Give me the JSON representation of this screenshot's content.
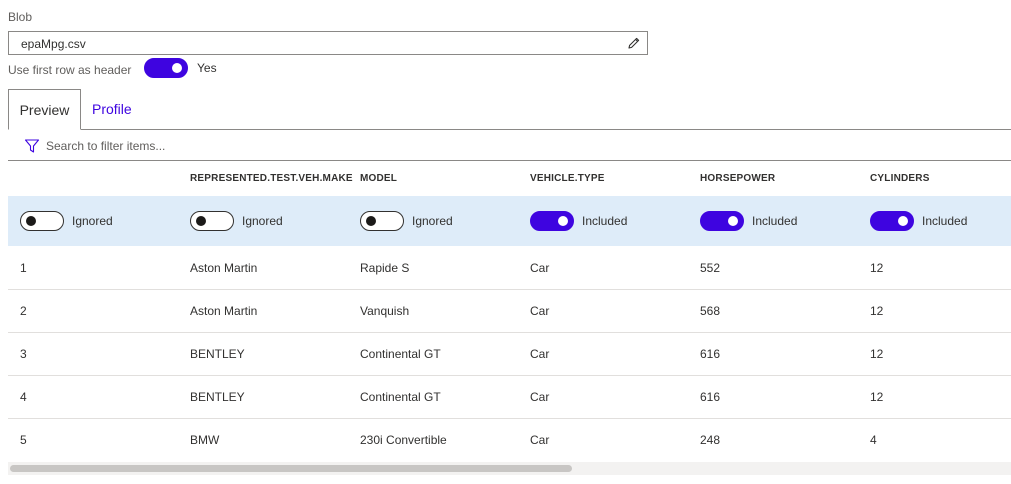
{
  "blob": {
    "label": "Blob",
    "value": "epaMpg.csv",
    "edit_icon": "pencil-icon"
  },
  "header_option": {
    "label": "Use first row as header",
    "enabled": true,
    "state": "Yes"
  },
  "tabs": [
    {
      "label": "Preview",
      "active": true
    },
    {
      "label": "Profile",
      "active": false
    }
  ],
  "search": {
    "placeholder": "Search to filter items...",
    "icon": "filter-icon"
  },
  "columns": [
    {
      "header": "",
      "included": false,
      "state": "Ignored"
    },
    {
      "header": "REPRESENTED.TEST.VEH.MAKE",
      "included": false,
      "state": "Ignored"
    },
    {
      "header": "MODEL",
      "included": false,
      "state": "Ignored"
    },
    {
      "header": "VEHICLE.TYPE",
      "included": true,
      "state": "Included"
    },
    {
      "header": "HORSEPOWER",
      "included": true,
      "state": "Included"
    },
    {
      "header": "CYLINDERS",
      "included": true,
      "state": "Included"
    }
  ],
  "rows": [
    [
      "1",
      "Aston Martin",
      "Rapide S",
      "Car",
      "552",
      "12"
    ],
    [
      "2",
      "Aston Martin",
      "Vanquish",
      "Car",
      "568",
      "12"
    ],
    [
      "3",
      "BENTLEY",
      "Continental GT",
      "Car",
      "616",
      "12"
    ],
    [
      "4",
      "BENTLEY",
      "Continental GT",
      "Car",
      "616",
      "12"
    ],
    [
      "5",
      "BMW",
      "230i Convertible",
      "Car",
      "248",
      "4"
    ]
  ],
  "colors": {
    "accent": "#3e04e0",
    "selected_row": "#deecf9",
    "border": "#8a8886"
  }
}
